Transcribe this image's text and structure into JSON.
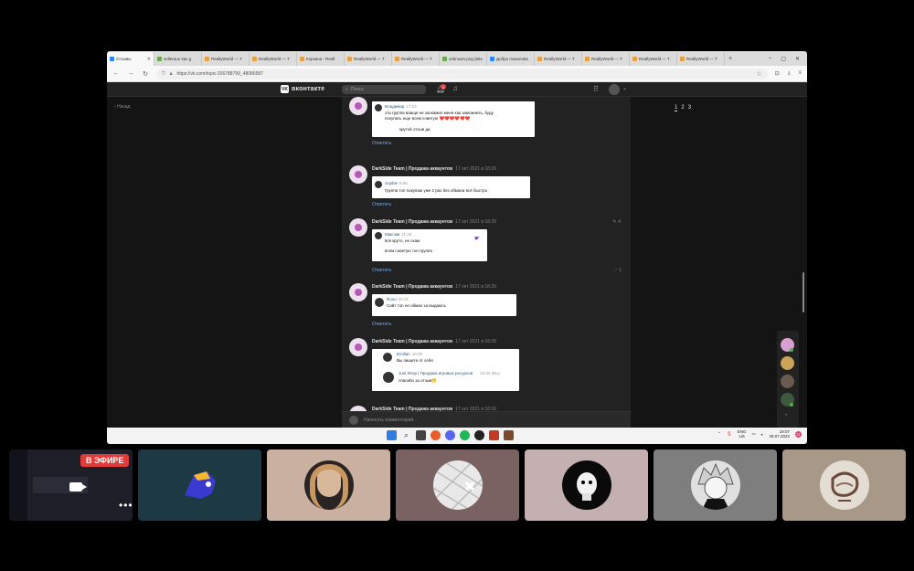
{
  "browser": {
    "tabs": [
      {
        "title": "Отзывы",
        "active": true,
        "favicon": "vk"
      },
      {
        "title": "selleraus 4ac g",
        "favicon": "gr"
      },
      {
        "title": "ReallyWorld — T",
        "favicon": "or"
      },
      {
        "title": "ReallyWorld — T",
        "favicon": "or"
      },
      {
        "title": "Корзина - Reall",
        "favicon": "or"
      },
      {
        "title": "ReallyWorld — T",
        "favicon": "or"
      },
      {
        "title": "ReallyWorld — T",
        "favicon": "or"
      },
      {
        "title": "unknown.png (66x",
        "favicon": "gr"
      },
      {
        "title": "Добро пожалова",
        "favicon": "vk"
      },
      {
        "title": "ReallyWorld — T",
        "favicon": "or"
      },
      {
        "title": "ReallyWorld — T",
        "favicon": "or"
      },
      {
        "title": "ReallyWorld — T",
        "favicon": "or"
      },
      {
        "title": "ReallyWorld — T",
        "favicon": "or"
      }
    ],
    "new_tab": "+",
    "controls": {
      "minimize": "–",
      "maximize": "▢",
      "close": "✕"
    },
    "url": "https://vk.com/topic-206788799_48086587",
    "nav": {
      "back": "←",
      "forward": "→",
      "reload": "↻"
    }
  },
  "vk": {
    "logo_text": "вконтакте",
    "logo_mark": "VK",
    "search_placeholder": "Поиск",
    "notif_count": "1",
    "back_label": "Назад",
    "pager": [
      "1",
      "2",
      "3"
    ],
    "comment_placeholder": "Написать комментарий...",
    "comments": [
      {
        "author": "",
        "date": "",
        "shot_lines": [
          {
            "name": "Владимир",
            "time": "17:23"
          },
          {
            "text": "эта группа вааще не заскамил меня как заможнить, буду"
          },
          {
            "text": "покупать еще всем советую ❤️❤️❤️❤️❤️❤️"
          },
          {
            "text": "крутой отзыв да"
          }
        ],
        "reply": "Ответить",
        "likes": ""
      },
      {
        "author": "DarkSide Team | Продажа аккаунтов",
        "date": "17 окт 2021 в 18:29",
        "shot_lines": [
          {
            "name": "Sophie",
            "time": "8:55"
          },
          {
            "text": "Группа топ покупаю уже 2 раз без обмана всё быстро"
          }
        ],
        "reply": "Ответить",
        "likes": ""
      },
      {
        "author": "DarkSide Team | Продажа аккаунтов",
        "date": "17 окт 2021 в 18:29",
        "shot_lines": [
          {
            "name": "Максим",
            "time": "11:29"
          },
          {
            "text": "всё круто, не скам"
          },
          {
            "text": "всем советую топ группа"
          }
        ],
        "reply": "Ответить",
        "likes": "1"
      },
      {
        "author": "DarkSide Team | Продажа аккаунтов",
        "date": "17 окт 2021 в 18:29",
        "shot_lines": [
          {
            "name": "Ruoo",
            "time": "20:31"
          },
          {
            "text": "Сайт топ не обман за выдаюсь"
          }
        ],
        "reply": "Ответить",
        "likes": ""
      },
      {
        "author": "DarkSide Team | Продажа аккаунтов",
        "date": "17 окт 2021 в 18:29",
        "shot_lines": [
          {
            "name": "Emilian",
            "time": "16:09"
          },
          {
            "text": "Вы пишите от себя"
          },
          {
            "name": "Just Shop | Продажа игровых ресурсов",
            "time": "22:32 (Вы)"
          },
          {
            "text": "спасибо за отзыв😁"
          }
        ],
        "reply": "Ответить",
        "likes": ""
      },
      {
        "author": "DarkSide Team | Продажа аккаунтов",
        "date": "17 окт 2021 в 18:29",
        "shot_lines": [],
        "reply": "",
        "likes": ""
      }
    ]
  },
  "taskbar": {
    "lang": [
      "ENG",
      "US"
    ],
    "time": "19:07",
    "date": "28.07.2022",
    "notifications": "21"
  },
  "call": {
    "live_label": "В ЭФИРЕ",
    "more": "•••"
  },
  "colors": {
    "vk_blue": "#2787f5",
    "live_red": "#e33a3a",
    "link": "#71aaeb"
  }
}
